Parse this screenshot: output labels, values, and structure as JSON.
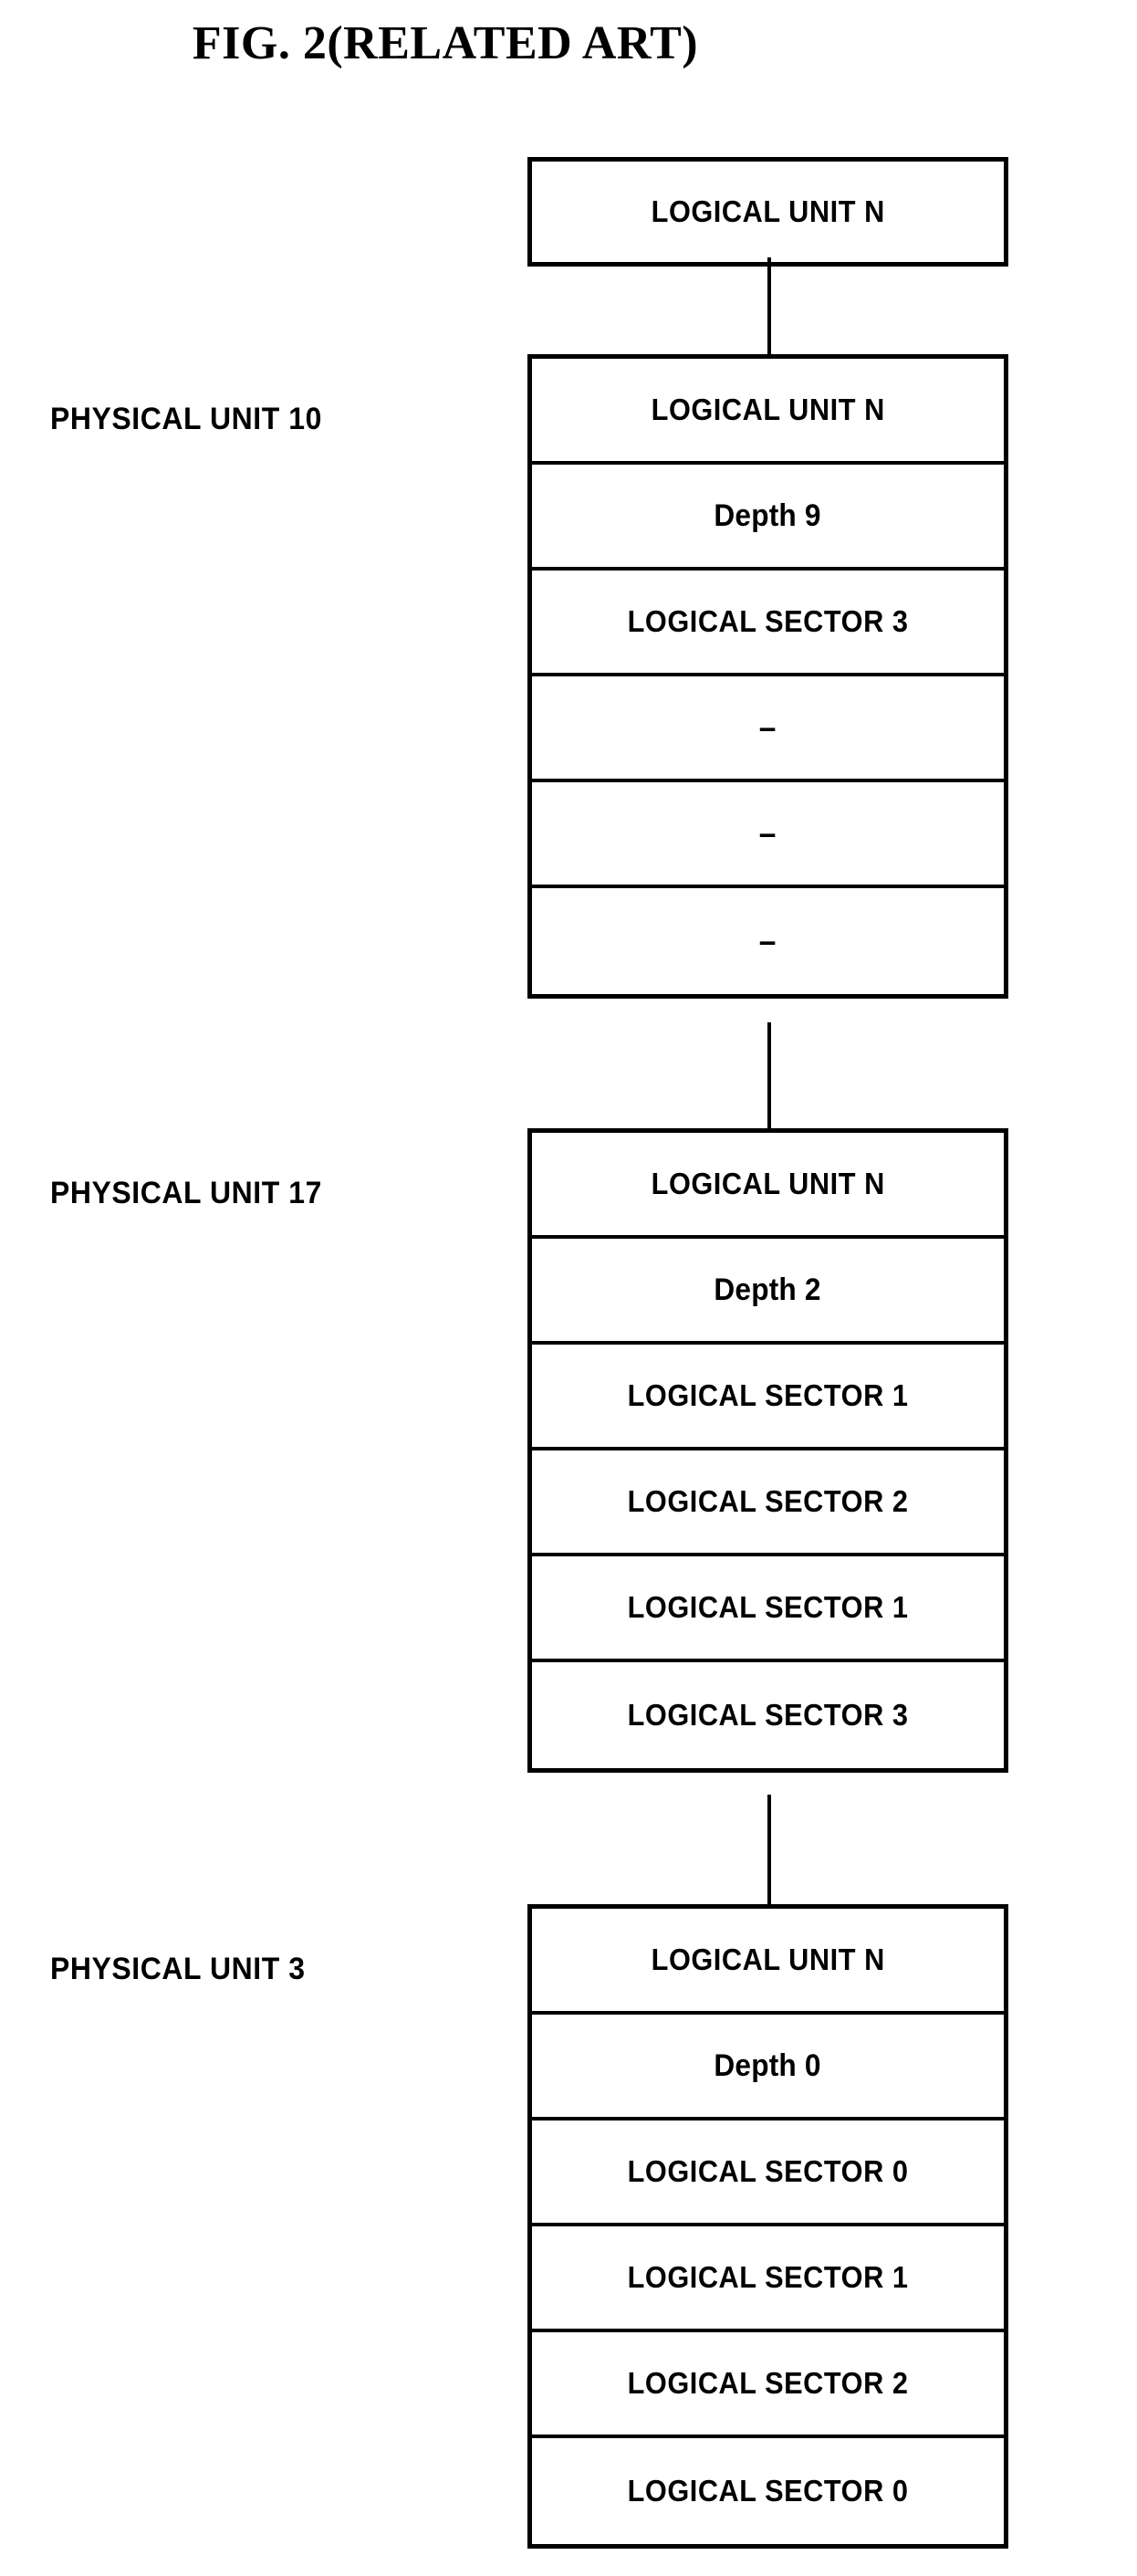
{
  "figure": {
    "title": "FIG. 2(RELATED ART)"
  },
  "diagram": {
    "type": "block-diagram",
    "description": "Logical-to-physical unit mapping chain for a flash memory device",
    "top_box": {
      "name": "logical-unit-root",
      "rows": [
        {
          "text": "LOGICAL UNIT N",
          "style": "upper"
        }
      ]
    },
    "units": [
      {
        "side_label": "PHYSICAL UNIT 10",
        "box_name": "physical-unit-10-box",
        "rows": [
          {
            "text": "LOGICAL UNIT N",
            "style": "upper"
          },
          {
            "text": "Depth 9",
            "style": "mixed"
          },
          {
            "text": "LOGICAL SECTOR 3",
            "style": "upper"
          },
          {
            "text": "–",
            "style": "dash"
          },
          {
            "text": "–",
            "style": "dash"
          },
          {
            "text": "–",
            "style": "dash"
          }
        ]
      },
      {
        "side_label": "PHYSICAL UNIT 17",
        "box_name": "physical-unit-17-box",
        "rows": [
          {
            "text": "LOGICAL UNIT N",
            "style": "upper"
          },
          {
            "text": "Depth 2",
            "style": "mixed"
          },
          {
            "text": "LOGICAL SECTOR 1",
            "style": "upper"
          },
          {
            "text": "LOGICAL SECTOR 2",
            "style": "upper"
          },
          {
            "text": "LOGICAL SECTOR 1",
            "style": "upper"
          },
          {
            "text": "LOGICAL SECTOR 3",
            "style": "upper"
          }
        ]
      },
      {
        "side_label": "PHYSICAL UNIT 3",
        "box_name": "physical-unit-3-box",
        "rows": [
          {
            "text": "LOGICAL UNIT N",
            "style": "upper"
          },
          {
            "text": "Depth 0",
            "style": "mixed"
          },
          {
            "text": "LOGICAL SECTOR 0",
            "style": "upper"
          },
          {
            "text": "LOGICAL SECTOR 1",
            "style": "upper"
          },
          {
            "text": "LOGICAL SECTOR 2",
            "style": "upper"
          },
          {
            "text": "LOGICAL SECTOR 0",
            "style": "upper"
          }
        ]
      }
    ],
    "connectors": [
      {
        "name": "connector-root-to-unit10",
        "from": "logical-unit-root",
        "to": "physical-unit-10-box"
      },
      {
        "name": "connector-unit10-to-unit17",
        "from": "physical-unit-10-box",
        "to": "physical-unit-17-box"
      },
      {
        "name": "connector-unit17-to-unit3",
        "from": "physical-unit-17-box",
        "to": "physical-unit-3-box"
      }
    ],
    "colors": {
      "ink": "#000000",
      "paper": "#ffffff"
    }
  }
}
